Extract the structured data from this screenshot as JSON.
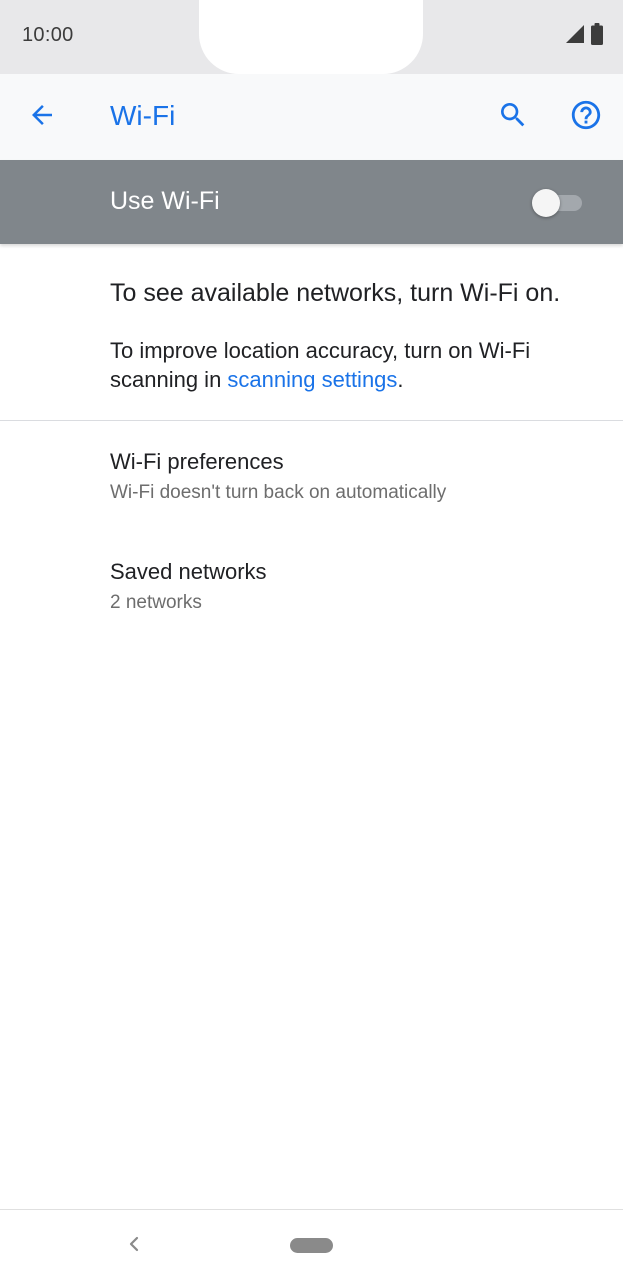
{
  "status_bar": {
    "time": "10:00",
    "icons": [
      "signal-icon",
      "battery-icon"
    ]
  },
  "app_bar": {
    "title": "Wi-Fi",
    "back_icon": "arrow-back-icon",
    "search_icon": "search-icon",
    "help_icon": "help-circle-icon"
  },
  "master_switch": {
    "label": "Use Wi-Fi",
    "state": "off"
  },
  "off_state": {
    "message": "To see available networks, turn Wi-Fi on.",
    "scan_text_before": "To improve location accuracy, turn on Wi-Fi scanning in ",
    "scan_link": "scanning settings",
    "scan_text_after": "."
  },
  "preferences": [
    {
      "title": "Wi-Fi preferences",
      "summary": "Wi-Fi doesn't turn back on automatically"
    },
    {
      "title": "Saved networks",
      "summary": "2 networks"
    }
  ],
  "colors": {
    "accent": "#1a73e8",
    "master_bar_off": "#80868b",
    "status_bar": "#e8e8ea",
    "app_bar": "#f8f9fa"
  },
  "nav_bar": {
    "back_icon": "nav-back-chevron-icon",
    "home_icon": "home-pill-icon"
  }
}
